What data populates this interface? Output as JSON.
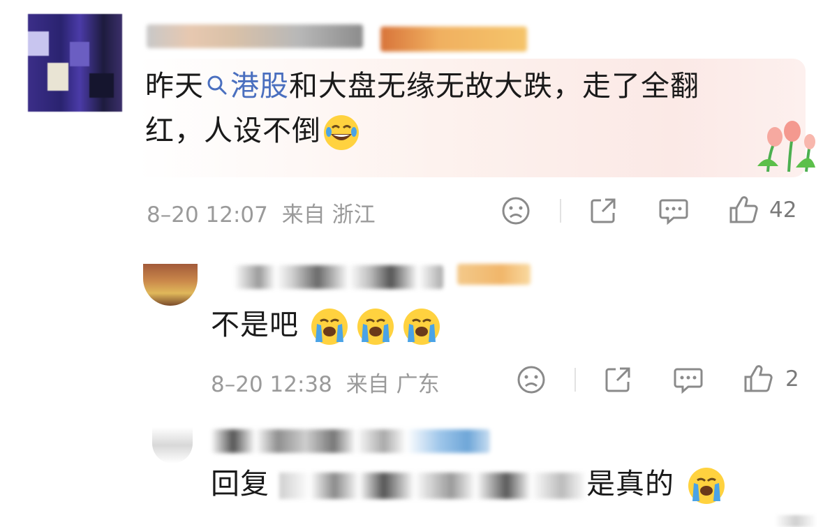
{
  "comments": [
    {
      "body_pre": "昨天",
      "body_tag": "港股",
      "body_post": "和大盘无缘无故大跌，走了全翻",
      "body_line2": "红，人设不倒",
      "date": "8–20 12:07",
      "location": "来自 浙江",
      "likes": "42"
    },
    {
      "body": "不是吧",
      "date": "8–20 12:38",
      "location": "来自 广东",
      "likes": "2"
    },
    {
      "body_prefix": "回复",
      "body_suffix": "是真的"
    }
  ],
  "icons": [
    "search-icon",
    "dislike-icon",
    "share-icon",
    "comment-icon",
    "like-icon"
  ],
  "colors": {
    "tag_blue": "#4a6fbf",
    "meta_gray": "#9a9a9a",
    "emoji_yellow": "#ffd23f",
    "tear_blue": "#4aa3e6"
  }
}
